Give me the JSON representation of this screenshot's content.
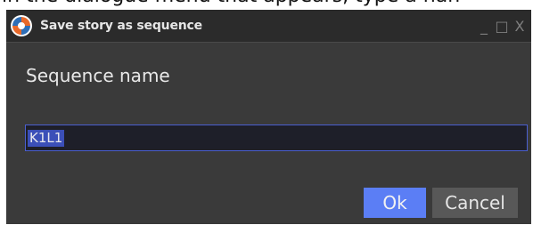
{
  "background_caption": "in the dialogue menu that appears, type a nan",
  "window": {
    "title": "Save story as sequence",
    "controls": {
      "minimize": "_",
      "maximize": "□",
      "close": "X"
    },
    "logo_icon": "app-logo-icon"
  },
  "form": {
    "label": "Sequence name",
    "input_value": "K1L1"
  },
  "buttons": {
    "ok": "Ok",
    "cancel": "Cancel"
  },
  "colors": {
    "accent": "#5b7ef5",
    "dialog_bg": "#3a3a3a",
    "titlebar_bg": "#2b2b2b",
    "input_bg": "#1e1f29",
    "selection": "#3b4fb8",
    "cancel_bg": "#585858"
  }
}
